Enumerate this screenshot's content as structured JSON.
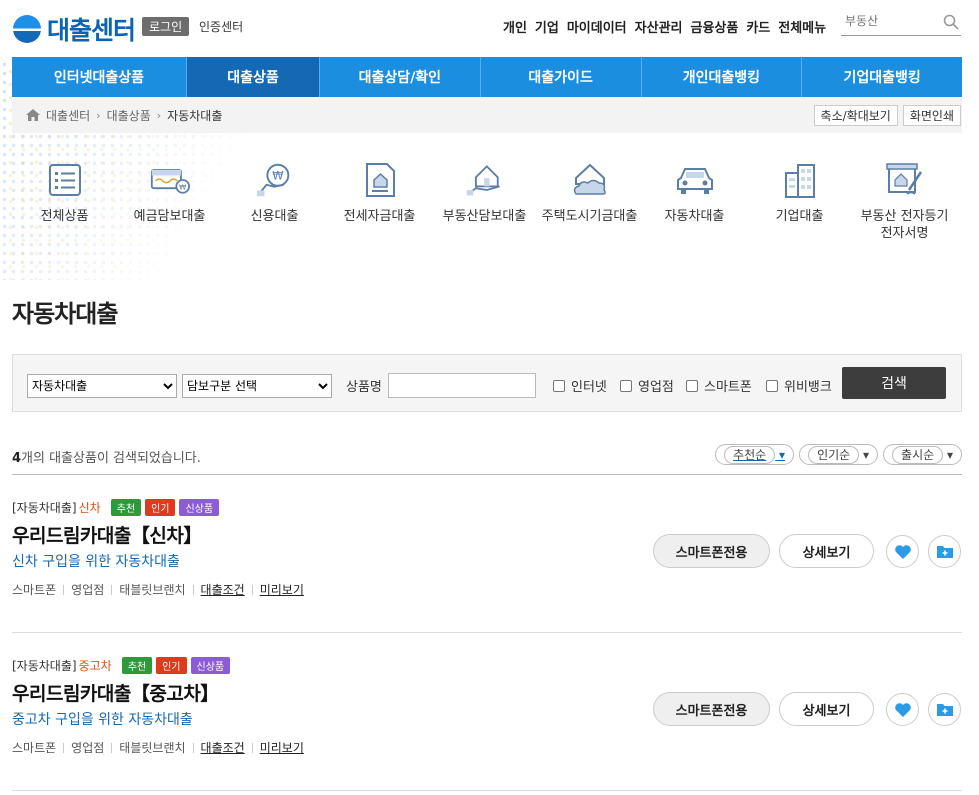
{
  "header": {
    "logo_text": "대출센터",
    "login_label": "로그인",
    "cert_label": "인증센터",
    "top_links": [
      "개인",
      "기업",
      "마이데이터",
      "자산관리",
      "금융상품",
      "카드",
      "전체메뉴"
    ],
    "search_placeholder": "부동산"
  },
  "main_nav": [
    {
      "label": "인터넷대출상품",
      "active": false
    },
    {
      "label": "대출상품",
      "active": true
    },
    {
      "label": "대출상담/확인",
      "active": false
    },
    {
      "label": "대출가이드",
      "active": false
    },
    {
      "label": "개인대출뱅킹",
      "active": false
    },
    {
      "label": "기업대출뱅킹",
      "active": false
    }
  ],
  "breadcrumb": {
    "items": [
      "대출센터",
      "대출상품",
      "자동차대출"
    ],
    "zoom_label": "축소/확대보기",
    "print_label": "화면인쇄"
  },
  "categories": [
    {
      "label": "전체상품",
      "icon": "list-icon"
    },
    {
      "label": "예금담보대출",
      "icon": "bankbook-icon"
    },
    {
      "label": "신용대출",
      "icon": "won-hand-icon"
    },
    {
      "label": "전세자금대출",
      "icon": "house-document-icon"
    },
    {
      "label": "부동산담보대출",
      "icon": "house-hand-icon"
    },
    {
      "label": "주택도시기금대출",
      "icon": "house-cloud-icon"
    },
    {
      "label": "자동차대출",
      "icon": "car-icon"
    },
    {
      "label": "기업대출",
      "icon": "building-icon"
    },
    {
      "label": "부동산 전자등기\n전자서명",
      "icon": "contract-sign-icon"
    }
  ],
  "page_title": "자동차대출",
  "search_panel": {
    "select1_value": "자동차대출",
    "select2_value": "담보구분 선택",
    "product_name_label": "상품명",
    "checkboxes": [
      "인터넷",
      "영업점",
      "스마트폰",
      "위비뱅크"
    ],
    "search_button": "검색"
  },
  "results": {
    "count_num": "4",
    "count_text": "개의 대출상품이 검색되었습니다.",
    "sorts": [
      "추천순",
      "인기순",
      "출시순"
    ]
  },
  "products": [
    {
      "category": "[자동차대출]",
      "subcategory": "신차",
      "tags": [
        "추천",
        "인기",
        "신상품"
      ],
      "name": "우리드림카대출【신차】",
      "desc": "신차 구입을 위한 자동차대출",
      "channels": [
        "스마트폰",
        "영업점",
        "태블릿브랜치"
      ],
      "links": [
        "대출조건",
        "미리보기"
      ],
      "smartphone_btn": "스마트폰전용",
      "detail_btn": "상세보기"
    },
    {
      "category": "[자동차대출]",
      "subcategory": "중고차",
      "tags": [
        "추천",
        "인기",
        "신상품"
      ],
      "name": "우리드림카대출【중고차】",
      "desc": "중고차 구입을 위한 자동차대출",
      "channels": [
        "스마트폰",
        "영업점",
        "태블릿브랜치"
      ],
      "links": [
        "대출조건",
        "미리보기"
      ],
      "smartphone_btn": "스마트폰전용",
      "detail_btn": "상세보기"
    }
  ],
  "colors": {
    "nav_blue": "#1c8ee0",
    "nav_active": "#1468b4",
    "desc_blue": "#1468b4",
    "tag_green": "#2e9a3a",
    "tag_red": "#dd3a1e",
    "tag_purple": "#8b5cd6"
  }
}
